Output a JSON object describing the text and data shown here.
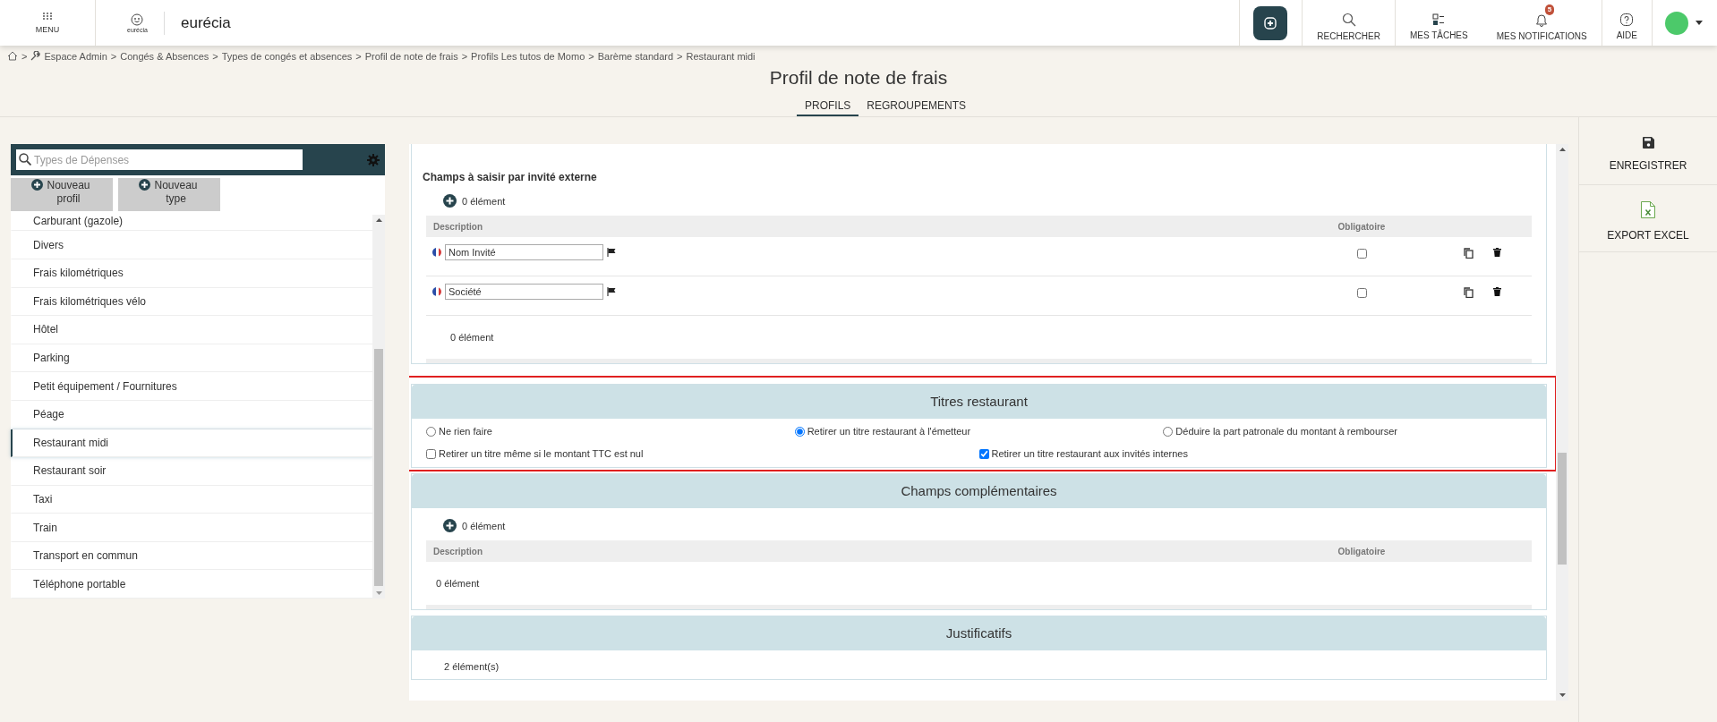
{
  "topbar": {
    "menu_label": "MENU",
    "logo_caption": "eurécia",
    "brand": "eurécia",
    "actions": [
      {
        "kind": "search",
        "label": "RECHERCHER"
      },
      {
        "kind": "tasks",
        "label": "MES TÂCHES"
      },
      {
        "kind": "notifications",
        "label": "MES NOTIFICATIONS",
        "badge": "5"
      },
      {
        "kind": "help",
        "label": "AIDE"
      }
    ]
  },
  "breadcrumb": {
    "separator": ">",
    "items": [
      "Espace Admin",
      "Congés & Absences",
      "Types de congés et absences",
      "Profil de note de frais",
      "Profils Les tutos de Momo",
      "Barème standard",
      "Restaurant midi"
    ]
  },
  "page_title": "Profil de note de frais",
  "tabs": [
    {
      "label": "PROFILS",
      "selected": true
    },
    {
      "label": "REGROUPEMENTS",
      "selected": false
    }
  ],
  "sidebar": {
    "search": {
      "placeholder": "Types de Dépenses"
    },
    "buttons": [
      "Nouveau profil",
      "Nouveau type"
    ],
    "items": [
      {
        "label": "Carburant (gazole)",
        "selected": false
      },
      {
        "label": "Divers",
        "selected": false
      },
      {
        "label": "Frais kilométriques",
        "selected": false
      },
      {
        "label": "Frais kilométriques vélo",
        "selected": false
      },
      {
        "label": "Hôtel",
        "selected": false
      },
      {
        "label": "Parking",
        "selected": false
      },
      {
        "label": "Petit équipement / Fournitures",
        "selected": false
      },
      {
        "label": "Péage",
        "selected": false
      },
      {
        "label": "Restaurant midi",
        "selected": true
      },
      {
        "label": "Restaurant soir",
        "selected": false
      },
      {
        "label": "Taxi",
        "selected": false
      },
      {
        "label": "Train",
        "selected": false
      },
      {
        "label": "Transport en commun",
        "selected": false
      },
      {
        "label": "Téléphone portable",
        "selected": false
      }
    ]
  },
  "sections": [
    {
      "kind": "table",
      "header_band": false,
      "highlighted": false,
      "title": "Champs à saisir par invité externe",
      "add_label": "0 élément",
      "columns": [
        "Description",
        "Obligatoire"
      ],
      "rows": [
        {
          "value": "Nom Invité",
          "required": false
        },
        {
          "value": "Société",
          "required": false
        }
      ],
      "footer": "0 élément"
    },
    {
      "kind": "options",
      "header_band": true,
      "highlighted": true,
      "title": "Titres restaurant",
      "radios": [
        {
          "label": "Ne rien faire",
          "selected": false
        },
        {
          "label": "Retirer un titre restaurant à l'émetteur",
          "selected": true
        },
        {
          "label": "Déduire la part patronale du montant à rembourser",
          "selected": false
        }
      ],
      "checkboxes": [
        {
          "label": "Retirer un titre même si le montant TTC est nul",
          "checked": false
        },
        {
          "label": "Retirer un titre restaurant aux invités internes",
          "checked": true
        }
      ]
    },
    {
      "kind": "table",
      "header_band": true,
      "highlighted": false,
      "title": "Champs complémentaires",
      "add_label": "0 élément",
      "columns": [
        "Description",
        "Obligatoire"
      ],
      "footer": "0 élément"
    },
    {
      "kind": "summary",
      "header_band": true,
      "highlighted": false,
      "title": "Justificatifs",
      "text": "2 élément(s)"
    }
  ],
  "actions": [
    {
      "kind": "save",
      "label": "ENREGISTRER"
    },
    {
      "kind": "excel",
      "label": "EXPORT EXCEL"
    }
  ]
}
